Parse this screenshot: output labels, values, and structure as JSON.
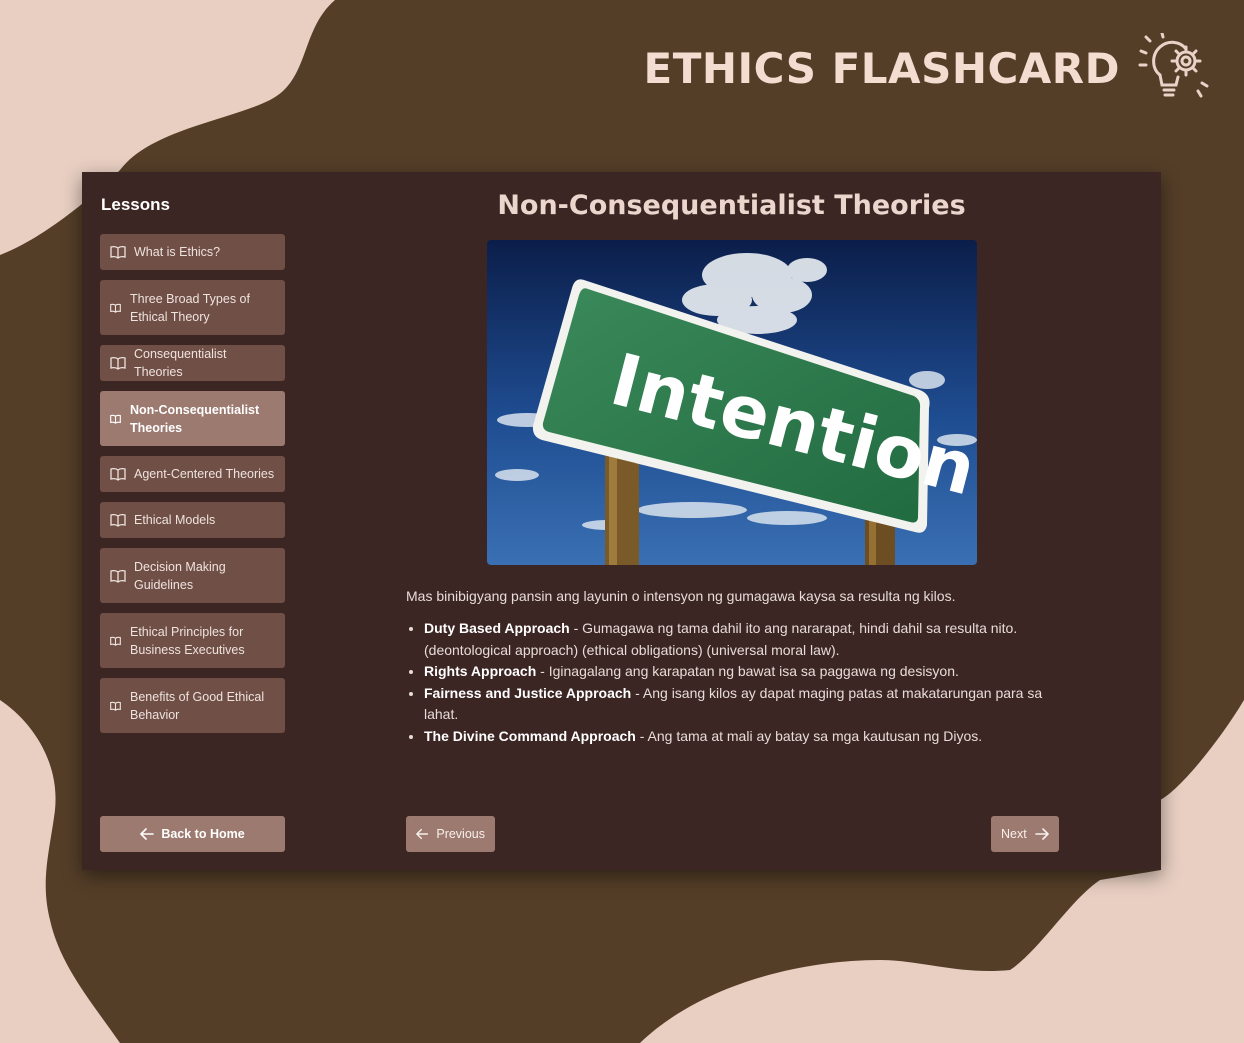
{
  "brand": {
    "title": "ETHICS FLASHCARD",
    "icon": "lightbulb-gear-icon"
  },
  "colors": {
    "background_light": "#e8cfc2",
    "background_dark": "#543e28",
    "panel": "#3c2624",
    "button": "#6f4f46",
    "button_active": "#9c7a70",
    "sign_green": "#2e7a4c"
  },
  "sidebar": {
    "heading": "Lessons",
    "items": [
      {
        "label": "What is Ethics?",
        "icon": "book-open-icon",
        "active": false
      },
      {
        "label": "Three Broad Types of Ethical Theory",
        "icon": "book-open-icon",
        "active": false
      },
      {
        "label": "Consequentialist Theories",
        "icon": "book-open-icon",
        "active": false
      },
      {
        "label": "Non-Consequentialist Theories",
        "icon": "book-open-icon",
        "active": true
      },
      {
        "label": "Agent-Centered Theories",
        "icon": "book-open-icon",
        "active": false
      },
      {
        "label": "Ethical Models",
        "icon": "book-open-icon",
        "active": false
      },
      {
        "label": "Decision Making Guidelines",
        "icon": "book-open-icon",
        "active": false
      },
      {
        "label": "Ethical Principles for Business Executives",
        "icon": "book-open-icon",
        "active": false
      },
      {
        "label": "Benefits of Good Ethical Behavior",
        "icon": "book-open-icon",
        "active": false
      }
    ],
    "home_label": "Back to Home"
  },
  "main": {
    "title": "Non-Consequentialist Theories",
    "image": {
      "sign_text": "Intention"
    },
    "intro": "Mas binibigyang pansin ang layunin o intensyon ng gumagawa kaysa sa resulta ng kilos.",
    "points": [
      {
        "term": "Duty Based Approach",
        "text": " - Gumagawa ng tama dahil ito ang nararapat, hindi dahil sa resulta nito. (deontological approach) (ethical obligations) (universal moral law)."
      },
      {
        "term": "Rights Approach",
        "text": " - Iginagalang ang karapatan ng bawat isa sa paggawa ng desisyon."
      },
      {
        "term": "Fairness and Justice Approach",
        "text": " - Ang isang kilos ay dapat maging patas at makatarungan para sa lahat."
      },
      {
        "term": "The Divine Command Approach",
        "text": " - Ang tama at mali ay batay sa mga kautusan ng Diyos."
      }
    ]
  },
  "nav": {
    "previous": "Previous",
    "next": "Next"
  }
}
